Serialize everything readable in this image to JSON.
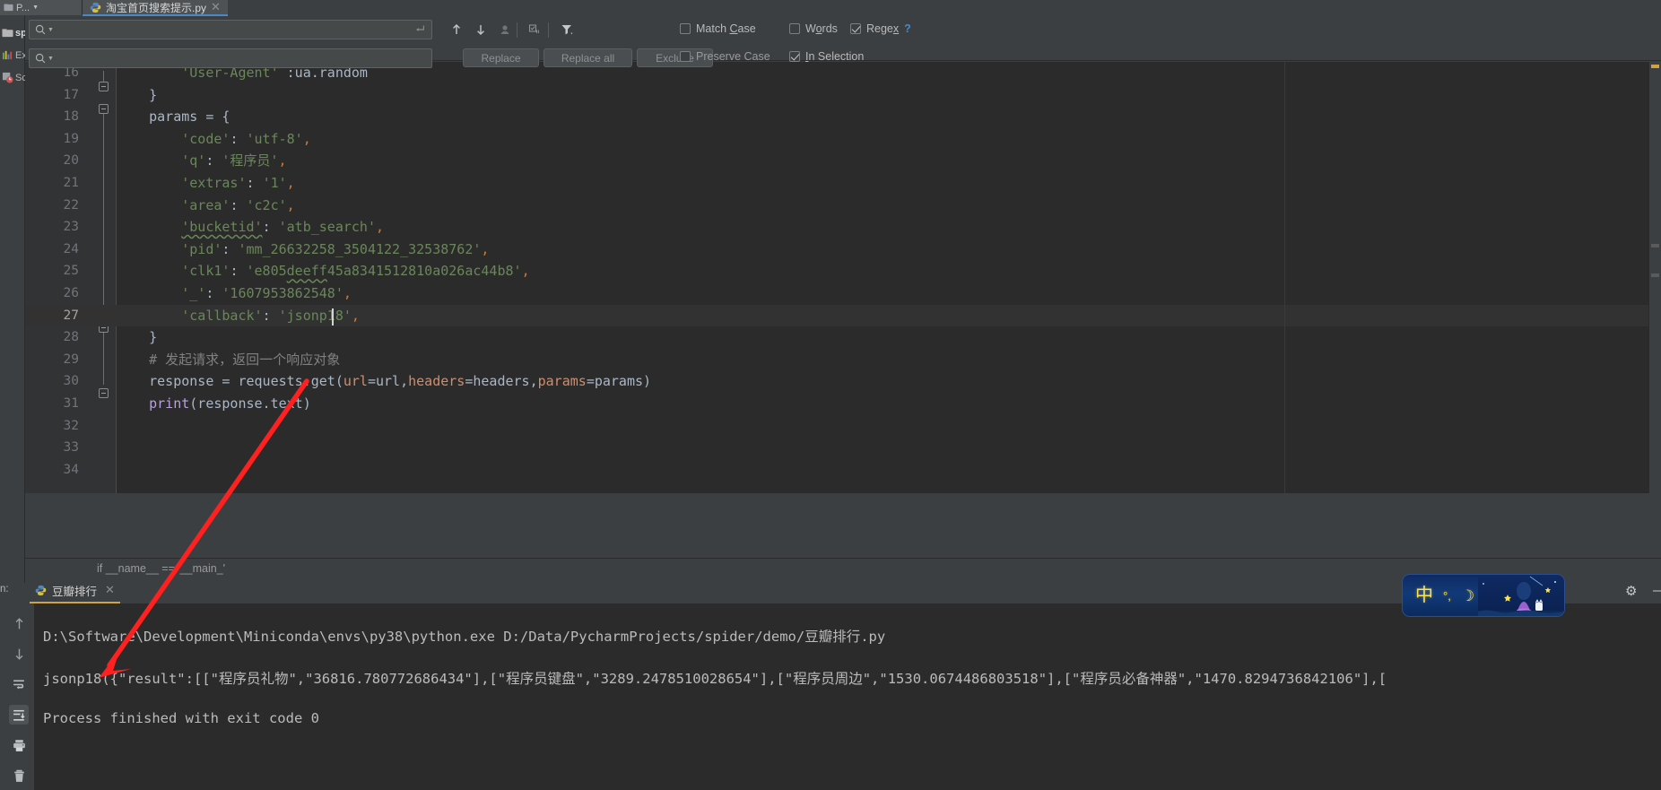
{
  "window": {
    "project_tab_label": "P...",
    "project_tab_icon": "project-folder-icon"
  },
  "left_toolwindows": [
    {
      "label": "sp",
      "icon": "folder-icon"
    },
    {
      "label": "Ex",
      "icon": "chart-bars-icon"
    },
    {
      "label": "Sc",
      "icon": "scientific-clock-icon"
    }
  ],
  "editor_tab": {
    "title": "淘宝首页搜索提示.py",
    "icon": "python-file-icon",
    "close_icon": "close-icon"
  },
  "find_panel": {
    "search_value": "",
    "search_placeholder": "",
    "replace_value": "",
    "replace_placeholder": "",
    "search_icon": "search-icon",
    "search_history_caret": "chevron-down-icon",
    "multiline_icon": "enter-multiline-icon",
    "prev_icon": "arrow-up-icon",
    "next_icon": "arrow-down-icon",
    "select_all_icon": "select-all-occurrences-icon",
    "open_in_find_icon": "open-in-find-window-icon",
    "filter_icon": "filter-icon",
    "buttons": [
      {
        "label": "Replace",
        "name": "replace-button"
      },
      {
        "label": "Replace all",
        "name": "replace-all-button"
      },
      {
        "label": "Exclude",
        "name": "exclude-button"
      }
    ],
    "checkboxes": [
      {
        "label": "Match Case",
        "underline": "C",
        "checked": false,
        "name": "match-case-checkbox"
      },
      {
        "label": "Words",
        "underline": "o",
        "checked": false,
        "name": "words-checkbox"
      },
      {
        "label": "Regex",
        "underline": "x",
        "checked": true,
        "name": "regex-checkbox"
      },
      {
        "label": "Preserve Case",
        "underline": "",
        "checked": false,
        "name": "preserve-case-checkbox"
      },
      {
        "label": "In Selection",
        "underline": "I",
        "checked": true,
        "name": "in-selection-checkbox"
      }
    ],
    "help_label": "?"
  },
  "editor": {
    "first_visible_line": 16,
    "current_line": 27,
    "lines": [
      {
        "n": 16,
        "html": "        <span class='s-str'>'User-Agent'</span><span class='s-id'> :ua.random</span>"
      },
      {
        "n": 17,
        "html": "    <span class='s-id'>}</span>",
        "fold": "end"
      },
      {
        "n": 18,
        "html": "    <span class='s-id'>params = {</span>",
        "fold": "start"
      },
      {
        "n": 19,
        "html": "        <span class='s-str'>'code'</span><span class='s-id'>: </span><span class='s-str'>'utf-8'</span><span class='s-pun'>,</span>"
      },
      {
        "n": 20,
        "html": "        <span class='s-str'>'q'</span><span class='s-id'>: </span><span class='s-str'>'程序员'</span><span class='s-pun'>,</span>"
      },
      {
        "n": 21,
        "html": "        <span class='s-str'>'extras'</span><span class='s-id'>: </span><span class='s-str'>'1'</span><span class='s-pun'>,</span>"
      },
      {
        "n": 22,
        "html": "        <span class='s-str'>'area'</span><span class='s-id'>: </span><span class='s-str'>'c2c'</span><span class='s-pun'>,</span>"
      },
      {
        "n": 23,
        "html": "        <span class='s-str typo'>'bucketid'</span><span class='s-id'>: </span><span class='s-str'>'atb_search'</span><span class='s-pun'>,</span>"
      },
      {
        "n": 24,
        "html": "        <span class='s-str'>'pid'</span><span class='s-id'>: </span><span class='s-str'>'mm_26632258_3504122_32538762'</span><span class='s-pun'>,</span>"
      },
      {
        "n": 25,
        "html": "        <span class='s-str'>'clk1'</span><span class='s-id'>: </span><span class='s-str'>'e805<span class='typo'>deeff</span>45a8341512810a026ac44b8'</span><span class='s-pun'>,</span>"
      },
      {
        "n": 26,
        "html": "        <span class='s-str'>'_'</span><span class='s-id'>: </span><span class='s-str'>'1607953862548'</span><span class='s-pun'>,</span>"
      },
      {
        "n": 27,
        "html": "        <span class='s-str'>'callback'</span><span class='s-id'>: </span><span class='s-str'>'jsonp18'</span><span class='s-pun'>,</span>"
      },
      {
        "n": 28,
        "html": "    <span class='s-id'>}</span>",
        "fold": "end"
      },
      {
        "n": 29,
        "html": "    <span class='s-com'># 发起请求，返回一个响应对象</span>"
      },
      {
        "n": 30,
        "html": "    <span class='s-id'>response = requests.get(</span><span class='s-par'>url</span><span class='s-id'>=url,</span><span class='s-par'>headers</span><span class='s-id'>=headers,</span><span class='s-par'>params</span><span class='s-id'>=params)</span>"
      },
      {
        "n": 31,
        "html": "    <span class='s-fn'>print</span><span class='s-id'>(response.text)</span>",
        "fold": "end"
      },
      {
        "n": 32,
        "html": ""
      },
      {
        "n": 33,
        "html": ""
      },
      {
        "n": 34,
        "html": ""
      }
    ],
    "plain_lines": [
      "        'User-Agent' :ua.random",
      "    }",
      "    params = {",
      "        'code': 'utf-8',",
      "        'q': '程序员',",
      "        'extras': '1',",
      "        'area': 'c2c',",
      "        'bucketid': 'atb_search',",
      "        'pid': 'mm_26632258_3504122_32538762',",
      "        'clk1': 'e805deeff45a8341512810a026ac44b8',",
      "        '_': '1607953862548',",
      "        'callback': 'jsonp18',",
      "    }",
      "    # 发起请求，返回一个响应对象",
      "    response = requests.get(url=url,headers=headers,params=params)",
      "    print(response.text)",
      "",
      "",
      ""
    ]
  },
  "breadcrumb": {
    "text": "if __name__ == '__main_'"
  },
  "run_panel": {
    "label": "n:",
    "tab_title": "豆瓣排行",
    "tab_icon": "python-file-icon",
    "close_icon": "close-icon",
    "tools": [
      {
        "name": "scroll-up-icon",
        "icon": "arrow-up-icon",
        "selected": false
      },
      {
        "name": "scroll-down-icon",
        "icon": "arrow-down-icon",
        "selected": false
      },
      {
        "name": "soft-wrap-icon",
        "icon": "soft-wrap-icon",
        "selected": false
      },
      {
        "name": "scroll-to-end-icon",
        "icon": "scroll-to-end-icon",
        "selected": true
      },
      {
        "name": "print-icon",
        "icon": "printer-icon",
        "selected": false
      },
      {
        "name": "clear-all-icon",
        "icon": "trash-icon",
        "selected": false
      }
    ],
    "console_lines": [
      "D:\\Software\\Development\\Miniconda\\envs\\py38\\python.exe D:/Data/PycharmProjects/spider/demo/豆瓣排行.py",
      "jsonp18({\"result\":[[\"程序员礼物\",\"36816.780772686434\"],[\"程序员键盘\",\"3289.2478510028654\"],[\"程序员周边\",\"1530.0674486803518\"],[\"程序员必备神器\",\"1470.8294736842106\"],[",
      "Process finished with exit code 0"
    ]
  },
  "ime_bar": {
    "mode_label": "中",
    "glyphs": [
      "中",
      "°,",
      "☽",
      "👕",
      "★"
    ],
    "icons": [
      "chinese-mode-icon",
      "punctuation-icon",
      "moon-icon",
      "skin-icon",
      "star-icon"
    ]
  },
  "window_controls": {
    "settings_icon": "gear-icon",
    "minimize_icon": "minimize-icon"
  },
  "colors": {
    "accent_tab": "#4a88c7",
    "run_tab_underline": "#d0a33c",
    "annotation_arrow": "#ff2020",
    "editor_bg": "#2b2b2b",
    "chrome_bg": "#3c3f41",
    "string_green": "#6a8759",
    "comment_gray": "#808080"
  }
}
